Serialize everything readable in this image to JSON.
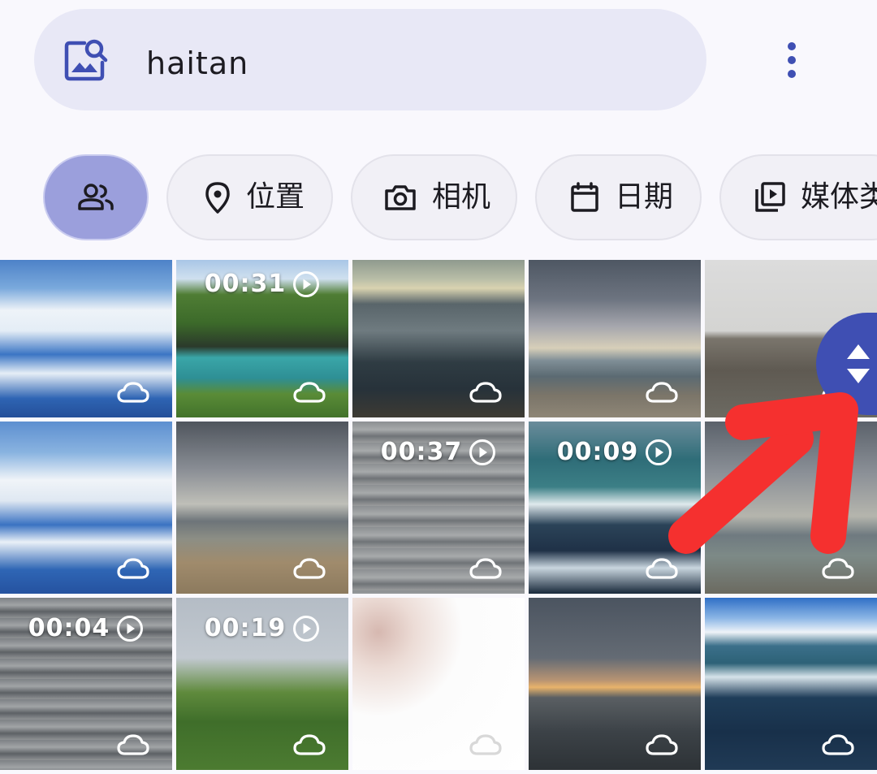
{
  "search": {
    "query": "haitan",
    "icon": "image-search-icon"
  },
  "header": {
    "menu_icon": "more-vert-icon"
  },
  "filters": [
    {
      "label": "",
      "icon": "people-icon",
      "selected": true
    },
    {
      "label": "位置",
      "icon": "location-pin-icon",
      "selected": false
    },
    {
      "label": "相机",
      "icon": "camera-icon",
      "selected": false
    },
    {
      "label": "日期",
      "icon": "calendar-icon",
      "selected": false
    },
    {
      "label": "媒体类",
      "icon": "media-type-icon",
      "selected": false
    }
  ],
  "grid": {
    "tiles": [
      {
        "type": "photo",
        "scene": "aerial clouds over ocean"
      },
      {
        "type": "video",
        "duration": "00:31",
        "scene": "green cliffs bay"
      },
      {
        "type": "photo",
        "scene": "person on rocks at sunset"
      },
      {
        "type": "photo",
        "scene": "cloudy shoreline"
      },
      {
        "type": "photo",
        "scene": "rocky grey shore"
      },
      {
        "type": "photo",
        "scene": "aerial clouds over ocean"
      },
      {
        "type": "photo",
        "scene": "cloudy sky sandy beach"
      },
      {
        "type": "video",
        "duration": "00:37",
        "scene": "grey waves"
      },
      {
        "type": "video",
        "duration": "00:09",
        "scene": "dark waves"
      },
      {
        "type": "photo",
        "scene": "cloudy shoreline"
      },
      {
        "type": "video",
        "duration": "00:04",
        "scene": "grey sea"
      },
      {
        "type": "video",
        "duration": "00:19",
        "scene": "tree branches"
      },
      {
        "type": "photo",
        "scene": "overexposed white"
      },
      {
        "type": "photo",
        "scene": "sunset horizon"
      },
      {
        "type": "photo",
        "scene": "blue sky beach waves"
      }
    ],
    "sync_icon": "cloud-icon"
  },
  "fast_scroll": {
    "icon": "up-down-arrows-icon",
    "color": "#3f4fb3"
  },
  "annotation": {
    "color": "#f5302f"
  }
}
